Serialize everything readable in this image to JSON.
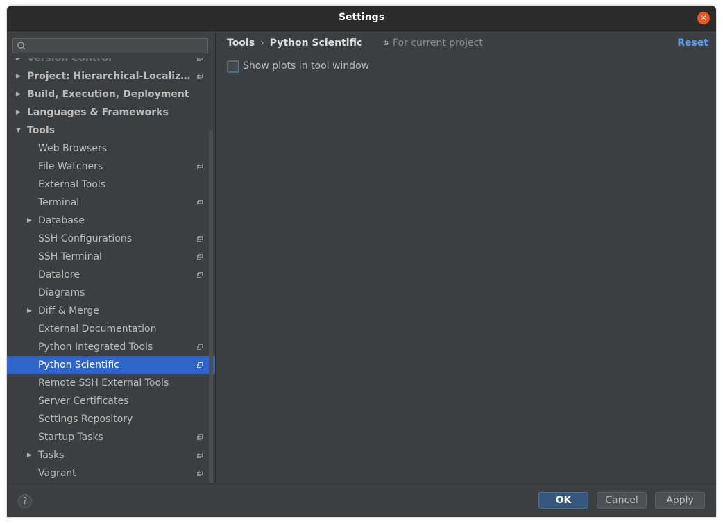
{
  "window": {
    "title": "Settings"
  },
  "search": {
    "placeholder": ""
  },
  "sidebar": {
    "items": [
      {
        "label": "Version Control",
        "level": 0,
        "arrow": "right",
        "project_icon": true,
        "faded": true
      },
      {
        "label": "Project: Hierarchical-Localiza...",
        "level": 0,
        "arrow": "right",
        "project_icon": true
      },
      {
        "label": "Build, Execution, Deployment",
        "level": 0,
        "arrow": "right",
        "project_icon": false
      },
      {
        "label": "Languages & Frameworks",
        "level": 0,
        "arrow": "right",
        "project_icon": false
      },
      {
        "label": "Tools",
        "level": 0,
        "arrow": "down",
        "project_icon": false
      },
      {
        "label": "Web Browsers",
        "level": 1,
        "arrow": "",
        "project_icon": false
      },
      {
        "label": "File Watchers",
        "level": 1,
        "arrow": "",
        "project_icon": true
      },
      {
        "label": "External Tools",
        "level": 1,
        "arrow": "",
        "project_icon": false
      },
      {
        "label": "Terminal",
        "level": 1,
        "arrow": "",
        "project_icon": true
      },
      {
        "label": "Database",
        "level": 1,
        "arrow": "right",
        "project_icon": false
      },
      {
        "label": "SSH Configurations",
        "level": 1,
        "arrow": "",
        "project_icon": true
      },
      {
        "label": "SSH Terminal",
        "level": 1,
        "arrow": "",
        "project_icon": true
      },
      {
        "label": "Datalore",
        "level": 1,
        "arrow": "",
        "project_icon": true
      },
      {
        "label": "Diagrams",
        "level": 1,
        "arrow": "",
        "project_icon": false
      },
      {
        "label": "Diff & Merge",
        "level": 1,
        "arrow": "right",
        "project_icon": false
      },
      {
        "label": "External Documentation",
        "level": 1,
        "arrow": "",
        "project_icon": false
      },
      {
        "label": "Python Integrated Tools",
        "level": 1,
        "arrow": "",
        "project_icon": true
      },
      {
        "label": "Python Scientific",
        "level": 1,
        "arrow": "",
        "project_icon": true,
        "selected": true
      },
      {
        "label": "Remote SSH External Tools",
        "level": 1,
        "arrow": "",
        "project_icon": false
      },
      {
        "label": "Server Certificates",
        "level": 1,
        "arrow": "",
        "project_icon": false
      },
      {
        "label": "Settings Repository",
        "level": 1,
        "arrow": "",
        "project_icon": false
      },
      {
        "label": "Startup Tasks",
        "level": 1,
        "arrow": "",
        "project_icon": true
      },
      {
        "label": "Tasks",
        "level": 1,
        "arrow": "right",
        "project_icon": true
      },
      {
        "label": "Vagrant",
        "level": 1,
        "arrow": "",
        "project_icon": true
      }
    ]
  },
  "content": {
    "breadcrumb": {
      "parent": "Tools",
      "separator": "›",
      "current": "Python Scientific"
    },
    "scope_label": "For current project",
    "reset_label": "Reset",
    "option": {
      "label": "Show plots in tool window",
      "checked": false
    }
  },
  "footer": {
    "help_label": "?",
    "ok_label": "OK",
    "cancel_label": "Cancel",
    "apply_label": "Apply"
  },
  "colors": {
    "accent": "#2f65ca",
    "link": "#589df6",
    "close": "#e9541f",
    "background": "#3c3f41"
  }
}
